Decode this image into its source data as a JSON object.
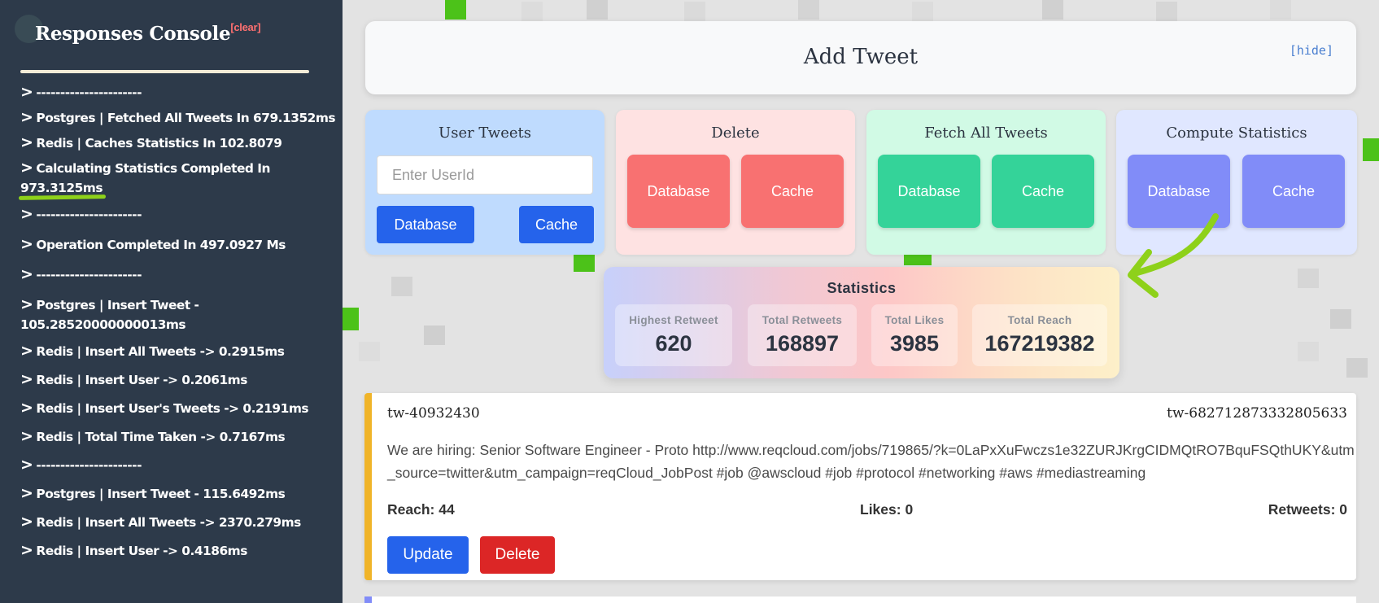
{
  "console": {
    "title": "Responses Console",
    "clear_label": "[clear]",
    "prompt": ">",
    "entries": [
      "----------------------",
      "Postgres | Fetched All Tweets In 679.1352ms",
      "Redis | Caches Statistics In 102.8079",
      "Calculating Statistics Completed In",
      "973.3125ms",
      "----------------------",
      "Operation Completed In 497.0927 Ms",
      "----------------------",
      "Postgres | Insert Tweet -",
      "105.28520000000013ms",
      "Redis | Insert All Tweets -> 0.2915ms",
      "Redis | Insert User -> 0.2061ms",
      "Redis | Insert User's Tweets -> 0.2191ms",
      "Redis | Total Time Taken -> 0.7167ms",
      "----------------------",
      "Postgres | Insert Tweet - 115.6492ms",
      "Redis | Insert All Tweets -> 2370.279ms",
      "Redis | Insert User -> 0.4186ms"
    ]
  },
  "add_tweet": {
    "title": "Add Tweet",
    "hide_label": "[hide]"
  },
  "cards": {
    "user_tweets": {
      "title": "User Tweets",
      "input_placeholder": "Enter UserId",
      "database_label": "Database",
      "cache_label": "Cache"
    },
    "delete": {
      "title": "Delete",
      "database_label": "Database",
      "cache_label": "Cache"
    },
    "fetch_all": {
      "title": "Fetch All Tweets",
      "database_label": "Database",
      "cache_label": "Cache"
    },
    "compute_stats": {
      "title": "Compute Statistics",
      "database_label": "Database",
      "cache_label": "Cache"
    }
  },
  "statistics": {
    "title": "Statistics",
    "highest_retweet": {
      "label": "Highest Retweet",
      "value": "620"
    },
    "total_retweets": {
      "label": "Total Retweets",
      "value": "168897"
    },
    "total_likes": {
      "label": "Total Likes",
      "value": "3985"
    },
    "total_reach": {
      "label": "Total Reach",
      "value": "167219382"
    }
  },
  "tweet": {
    "user_id": "tw-40932430",
    "tweet_id": "tw-682712873332805633",
    "text": "We are hiring: Senior Software Engineer - Proto http://www.reqcloud.com/jobs/719865/?k=0LaPxXuFwczs1e32ZURJKrgCIDMQtRO7BquFSQthUKY&utm_source=twitter&utm_campaign=reqCloud_JobPost #job @awscloud #job #protocol #networking #aws #mediastreaming",
    "reach": "Reach: 44",
    "likes": "Likes: 0",
    "retweets": "Retweets: 0",
    "update_label": "Update",
    "delete_label": "Delete"
  },
  "colors": {
    "console_bg": "#2d3a4a",
    "highlight": "#8ed11a",
    "primary_blue": "#2563eb",
    "danger_red": "#dc2626",
    "tweet_accent": "#f0b429"
  }
}
